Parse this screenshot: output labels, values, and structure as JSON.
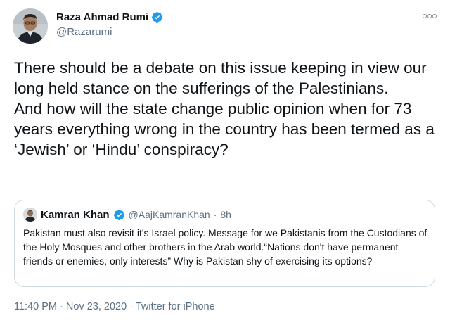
{
  "author": {
    "display_name": "Raza Ahmad Rumi",
    "handle": "@Razarumi",
    "verified": true
  },
  "tweet": {
    "text": "There should be a debate on this issue keeping in view our long held stance on the sufferings of the Palestinians.\nAnd how will the state change public opinion when for 73 years everything wrong in the country has been termed as a ‘Jewish’ or ‘Hindu’ conspiracy?",
    "time": "11:40 PM",
    "date": "Nov 23, 2020",
    "source": "Twitter for iPhone",
    "separator": "·"
  },
  "quoted_tweet": {
    "display_name": "Kamran Khan",
    "handle": "@AajKamranKhan",
    "age": "8h",
    "separator": "·",
    "verified": true,
    "text": "Pakistan must also revisit it's Israel policy. Message for we Pakistanis from the Custodians of the Holy Mosques and other brothers in the Arab world.“Nations don't have permanent friends or enemies, only interests” Why is Pakistan shy of exercising its options?"
  },
  "icons": {
    "more": "more-options-icon",
    "verified": "verified-badge-icon"
  },
  "colors": {
    "text": "#0f1419",
    "secondary": "#5b7083",
    "verified": "#1d9bf0",
    "border": "#cfd9de"
  }
}
